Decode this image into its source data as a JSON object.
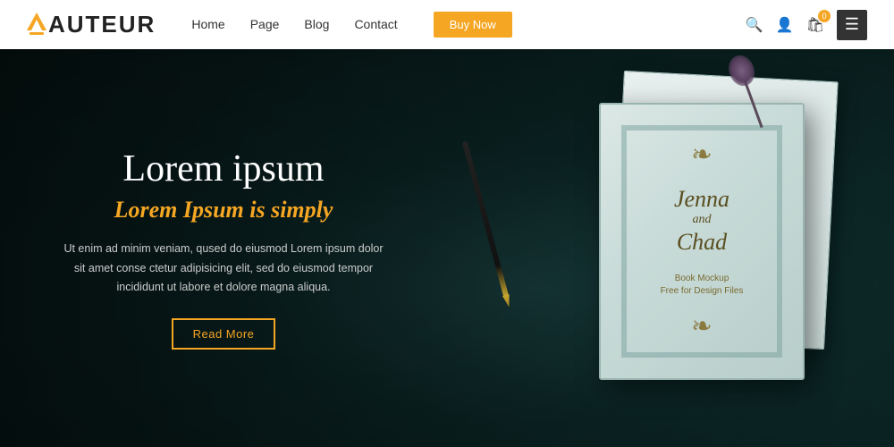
{
  "navbar": {
    "logo_text": "AUTEUR",
    "nav_links": [
      {
        "label": "Home",
        "id": "home"
      },
      {
        "label": "Page",
        "id": "page"
      },
      {
        "label": "Blog",
        "id": "blog"
      },
      {
        "label": "Contact",
        "id": "contact"
      }
    ],
    "buy_button_label": "Buy Now",
    "cart_badge": "0",
    "icons": {
      "search": "🔍",
      "user": "👤",
      "cart": "🛒",
      "menu": "☰"
    }
  },
  "hero": {
    "heading": "Lorem ipsum",
    "subheading": "Lorem Ipsum is simply",
    "description": "Ut enim ad minim veniam, qused do eiusmod Lorem ipsum dolor sit amet conse ctetur adipisicing elit, sed do eiusmod tempor incididunt ut labore et dolore magna aliqua.",
    "read_more_label": "Read More",
    "book": {
      "title_line1": "Jenna",
      "title_line2": "and",
      "title_line3": "Chad",
      "subtitle_line1": "Book Mockup",
      "subtitle_line2": "Free for Design Files"
    }
  }
}
